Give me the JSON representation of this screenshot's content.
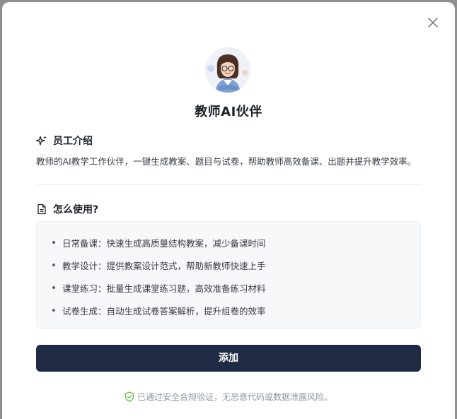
{
  "dialog": {
    "title": "教师AI伙伴",
    "close_icon": "close-icon",
    "avatar_icon": "teacher-avatar"
  },
  "intro": {
    "heading": "员工介绍",
    "heading_icon": "sparkle-icon",
    "text": "教师的AI教学工作伙伴，一键生成教案、题目与试卷，帮助教师高效备课、出题并提升教学效率。"
  },
  "usage": {
    "heading": "怎么使用?",
    "heading_icon": "document-icon",
    "items": [
      {
        "label": "日常备课：快速生成高质量结构教案，减少备课时间"
      },
      {
        "label": "教学设计：提供教案设计范式，帮助新教师快速上手"
      },
      {
        "label": "课堂练习：批量生成课堂练习题，高效准备练习材料"
      },
      {
        "label": "试卷生成：自动生成试卷答案解析，提升组卷的效率"
      }
    ]
  },
  "actions": {
    "add_label": "添加"
  },
  "footer": {
    "security_text": "已通过安全合规验证，无恶意代码或数据泄露风险。",
    "security_icon": "shield-check-icon",
    "security_color": "#6cc04a"
  },
  "colors": {
    "button_bg": "#1f2a44",
    "panel_bg": "#f7f8fa",
    "text_primary": "#1f2329"
  }
}
